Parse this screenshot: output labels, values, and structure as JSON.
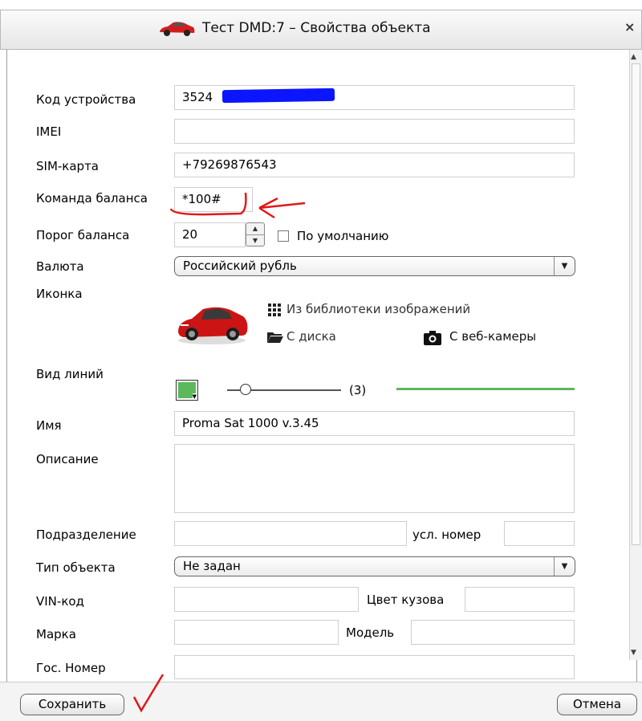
{
  "window": {
    "title": "Тест DMD:7 – Свойства объекта",
    "close_glyph": "×"
  },
  "form": {
    "device_code": {
      "label": "Код устройства",
      "value": "3524"
    },
    "imei": {
      "label": "IMEI",
      "value": ""
    },
    "sim": {
      "label": "SIM-карта",
      "value": "+79269876543"
    },
    "balance_command": {
      "label": "Команда баланса",
      "value": "*100#"
    },
    "balance_threshold": {
      "label": "Порог баланса",
      "value": "20",
      "default_checkbox_label": "По умолчанию"
    },
    "currency": {
      "label": "Валюта",
      "value": "Российский рубль"
    },
    "icon": {
      "label": "Иконка",
      "from_library": "Из библиотеки изображений",
      "from_disk": "С диска",
      "from_webcam": "С веб-камеры"
    },
    "line_style": {
      "label": "Вид линий",
      "width_display": "(3)",
      "color": "#5cb85c"
    },
    "name": {
      "label": "Имя",
      "value": "Proma Sat 1000 v.3.45"
    },
    "description": {
      "label": "Описание",
      "value": ""
    },
    "division": {
      "label": "Подразделение",
      "value": "",
      "cond_number_label": "усл. номер",
      "cond_number_value": ""
    },
    "object_type": {
      "label": "Тип объекта",
      "value": "Не задан"
    },
    "vin": {
      "label": "VIN-код",
      "value": "",
      "body_color_label": "Цвет кузова",
      "body_color_value": ""
    },
    "brand": {
      "label": "Марка",
      "value": "",
      "model_label": "Модель",
      "model_value": ""
    },
    "plate": {
      "label": "Гос. Номер",
      "value": ""
    }
  },
  "footer": {
    "save_label": "Сохранить",
    "cancel_label": "Отмена"
  },
  "annotations": {
    "color": "#e01818"
  }
}
